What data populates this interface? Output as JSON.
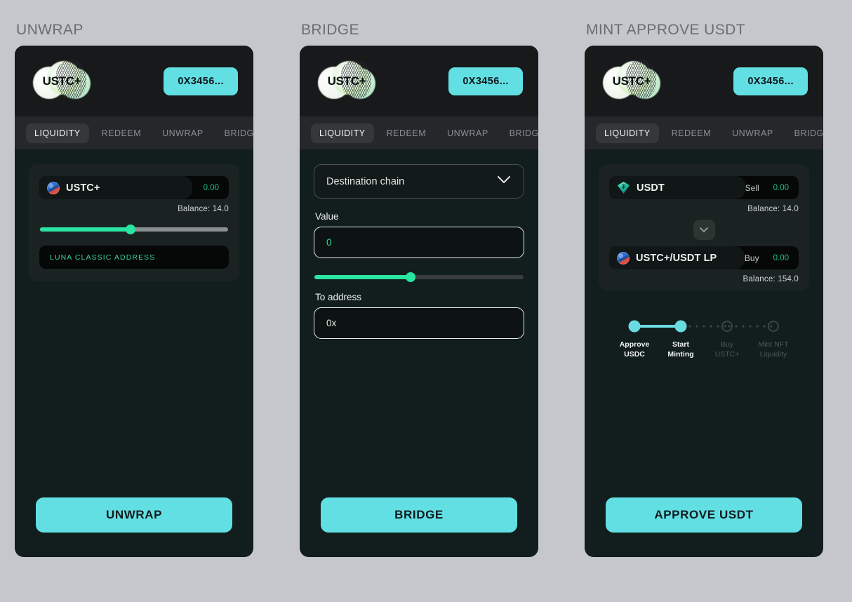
{
  "theme": {
    "page_bg": "#c6c7cc",
    "panel_bg": "#121e1e",
    "header_bg": "#17191b",
    "tabs_bg": "#25272b",
    "accent_cyan": "#62dfe3",
    "accent_green": "#2ae4a2",
    "title_gray": "#696d73"
  },
  "panels": [
    {
      "title": "UNWRAP",
      "header": {
        "logo_text": "USTC+",
        "wallet_label": "0X3456..."
      },
      "tabs": [
        {
          "label": "LIQUIDITY",
          "active": true
        },
        {
          "label": "REDEEM",
          "active": false
        },
        {
          "label": "UNWRAP",
          "active": false
        },
        {
          "label": "BRIDGE",
          "active": false
        }
      ],
      "token_row": {
        "icon": "ustc-coin-icon",
        "name": "USTC+",
        "amount": "0.00",
        "balance": "Balance: 14.0"
      },
      "slider": {
        "percent": 48
      },
      "address_input": {
        "value": "",
        "placeholder": "LUNA CLASSIC ADDRESS"
      },
      "cta_label": "UNWRAP"
    },
    {
      "title": "BRIDGE",
      "header": {
        "logo_text": "USTC+",
        "wallet_label": "0X3456..."
      },
      "tabs": [
        {
          "label": "LIQUIDITY",
          "active": true
        },
        {
          "label": "REDEEM",
          "active": false
        },
        {
          "label": "UNWRAP",
          "active": false
        },
        {
          "label": "BRIDGE",
          "active": false
        }
      ],
      "destination_select": {
        "value": "Destination chain",
        "icon": "chevron-down-icon"
      },
      "value_field": {
        "label": "Value",
        "value": "",
        "placeholder": "0"
      },
      "slider": {
        "percent": 46
      },
      "to_address_field": {
        "label": "To address",
        "value": "",
        "placeholder": "0x"
      },
      "cta_label": "BRIDGE"
    },
    {
      "title": "MINT APPROVE USDT",
      "header": {
        "logo_text": "USTC+",
        "wallet_label": "0X3456..."
      },
      "tabs": [
        {
          "label": "LIQUIDITY",
          "active": true
        },
        {
          "label": "REDEEM",
          "active": false
        },
        {
          "label": "UNWRAP",
          "active": false
        },
        {
          "label": "BRIDGE",
          "active": false
        }
      ],
      "sell_row": {
        "icon": "usdt-gem-icon",
        "name": "USDT",
        "side": "Sell",
        "amount": "0.00",
        "balance": "Balance: 14.0"
      },
      "swap_button": {
        "icon": "chevron-down-icon"
      },
      "buy_row": {
        "icon": "ustc-coin-icon",
        "name": "USTC+/USDT LP",
        "side": "Buy",
        "amount": "0.00",
        "balance": "Balance: 154.0"
      },
      "stepper": {
        "steps": [
          {
            "line1": "Approve",
            "line2": "USDC",
            "state": "done"
          },
          {
            "line1": "Start",
            "line2": "Minting",
            "state": "current"
          },
          {
            "line1": "Buy",
            "line2": "USTC+",
            "state": "pending"
          },
          {
            "line1": "Mint NFT",
            "line2": "Liquidity",
            "state": "pending"
          }
        ]
      },
      "cta_label": "APPROVE USDT"
    }
  ]
}
